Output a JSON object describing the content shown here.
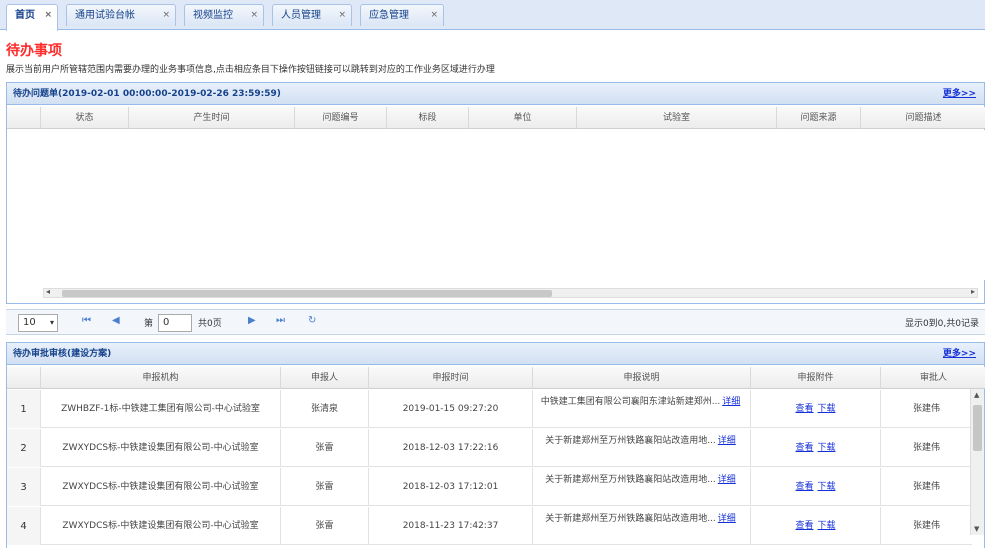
{
  "tabs": [
    {
      "label": "首页",
      "active": true
    },
    {
      "label": "通用试验台帐",
      "active": false
    },
    {
      "label": "视频监控",
      "active": false
    },
    {
      "label": "人员管理",
      "active": false
    },
    {
      "label": "应急管理",
      "active": false
    }
  ],
  "close_glyph": "×",
  "todo": {
    "title": "待办事项",
    "desc": "展示当前用户所管辖范围内需要办理的业务事项信息,点击相应条目下操作按钮链接可以跳转到对应的工作业务区域进行办理"
  },
  "problems": {
    "title": "待办问题单(2019-02-01 00:00:00-2019-02-26 23:59:59)",
    "more": "更多>>",
    "columns": [
      "状态",
      "产生时间",
      "问题编号",
      "标段",
      "单位",
      "试验室",
      "问题来源",
      "问题描述"
    ]
  },
  "pager": {
    "page_size": "10",
    "page_label": "第",
    "page_value": "0",
    "total_pages": "共0页",
    "info": "显示0到0,共0记录"
  },
  "plans": {
    "title": "待办审批审核(建设方案)",
    "more": "更多>>",
    "columns": [
      "申报机构",
      "申报人",
      "申报时间",
      "申报说明",
      "申报附件",
      "审批人"
    ],
    "rows": [
      {
        "num": "1",
        "org": "ZWHBZF-1标-中铁建工集团有限公司-中心试验室",
        "person": "张清泉",
        "time": "2019-01-15 09:27:20",
        "desc": "中铁建工集团有限公司襄阳东津站新建郑州...",
        "detail": "详细",
        "view": "查看",
        "download": "下载",
        "approver": "张建伟"
      },
      {
        "num": "2",
        "org": "ZWXYDCS标-中铁建设集团有限公司-中心试验室",
        "person": "张雷",
        "time": "2018-12-03 17:22:16",
        "desc": "关于新建郑州至万州铁路襄阳站改造用地...",
        "detail": "详细",
        "view": "查看",
        "download": "下载",
        "approver": "张建伟"
      },
      {
        "num": "3",
        "org": "ZWXYDCS标-中铁建设集团有限公司-中心试验室",
        "person": "张雷",
        "time": "2018-12-03 17:12:01",
        "desc": "关于新建郑州至万州铁路襄阳站改造用地...",
        "detail": "详细",
        "view": "查看",
        "download": "下载",
        "approver": "张建伟"
      },
      {
        "num": "4",
        "org": "ZWXYDCS标-中铁建设集团有限公司-中心试验室",
        "person": "张雷",
        "time": "2018-11-23 17:42:37",
        "desc": "关于新建郑州至万州铁路襄阳站改造用地...",
        "detail": "详细",
        "view": "查看",
        "download": "下载",
        "approver": "张建伟"
      }
    ]
  },
  "colors": {
    "accent": "#15428b",
    "title_red": "#ff2a2a",
    "link": "#1530d8"
  }
}
